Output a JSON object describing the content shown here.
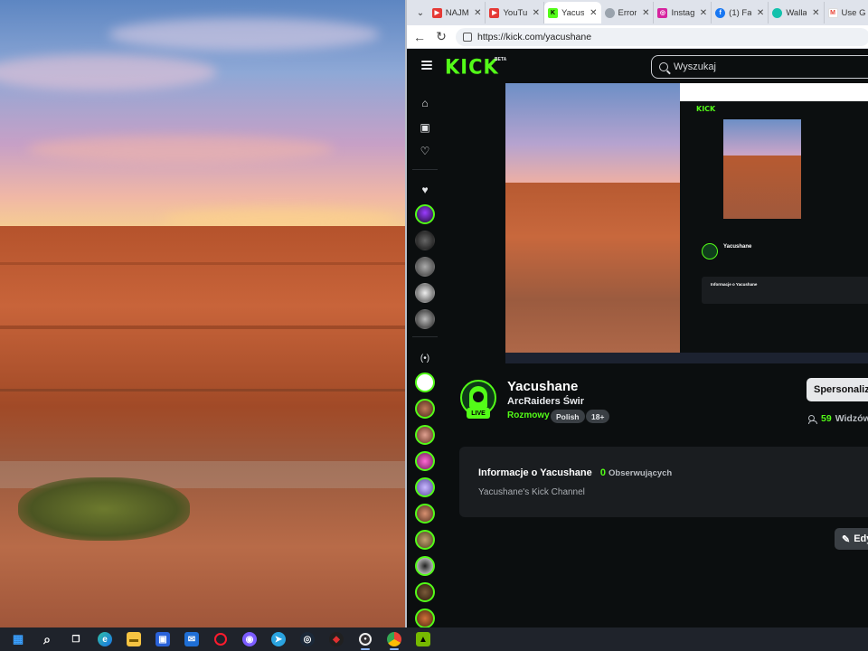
{
  "browser": {
    "tabs": [
      {
        "title": "NAJM",
        "icon": "youtube-icon",
        "color": "#e53935",
        "active": false
      },
      {
        "title": "YouTu",
        "icon": "youtube-icon",
        "color": "#e53935",
        "active": false
      },
      {
        "title": "Yacus",
        "icon": "kick-icon",
        "color": "#53fc18",
        "active": true
      },
      {
        "title": "Error",
        "icon": "error-icon",
        "color": "#9aa3ad",
        "active": false
      },
      {
        "title": "Instag",
        "icon": "instagram-icon",
        "color": "#d6249f",
        "active": false
      },
      {
        "title": "(1) Fa",
        "icon": "facebook-icon",
        "color": "#1877f2",
        "active": false
      },
      {
        "title": "Walla",
        "icon": "wallapop-icon",
        "color": "#13c1ac",
        "active": false
      },
      {
        "title": "Use G",
        "icon": "gmail-icon",
        "color": "#ea4335",
        "active": false
      }
    ],
    "url": "https://kick.com/yacushane"
  },
  "kick": {
    "logo": "KICK",
    "beta": "BETA",
    "search_placeholder": "Wyszukaj",
    "channel": {
      "name": "Yacushane",
      "stream_title": "ArcRaiders Świr",
      "category": "Rozmowy",
      "tags": [
        "Polish",
        "18+"
      ],
      "live_label": "LIVE",
      "viewers_count": "59",
      "viewers_label": "Widzów"
    },
    "sponsor_button": "Spersonalizuj",
    "about": {
      "title": "Informacje o Yacushane",
      "followers_count": "0",
      "followers_label": "Obserwujących",
      "description": "Yacushane's Kick Channel"
    },
    "edit_button": "Edytuj",
    "mini": {
      "logo": "KICK",
      "name": "Yacushane",
      "info": "Informacje o Yacushane"
    }
  },
  "taskbar": {
    "items": [
      {
        "icon": "start-icon",
        "glyph": "▦"
      },
      {
        "icon": "search-icon",
        "glyph": "⌕"
      },
      {
        "icon": "task-view-icon",
        "glyph": "❐"
      },
      {
        "icon": "edge-icon",
        "glyph": "e"
      },
      {
        "icon": "file-explorer-icon",
        "glyph": "▬"
      },
      {
        "icon": "microsoft-store-icon",
        "glyph": "▣"
      },
      {
        "icon": "mail-icon",
        "glyph": "✉"
      },
      {
        "icon": "opera-icon",
        "glyph": "O"
      },
      {
        "icon": "discord-icon",
        "glyph": "◉"
      },
      {
        "icon": "telegram-icon",
        "glyph": "➤"
      },
      {
        "icon": "steam-icon",
        "glyph": "◎"
      },
      {
        "icon": "app-icon",
        "glyph": "◆"
      },
      {
        "icon": "obs-icon",
        "glyph": "●"
      },
      {
        "icon": "chrome-icon",
        "glyph": "◍"
      },
      {
        "icon": "nvidia-icon",
        "glyph": "▲"
      }
    ]
  }
}
